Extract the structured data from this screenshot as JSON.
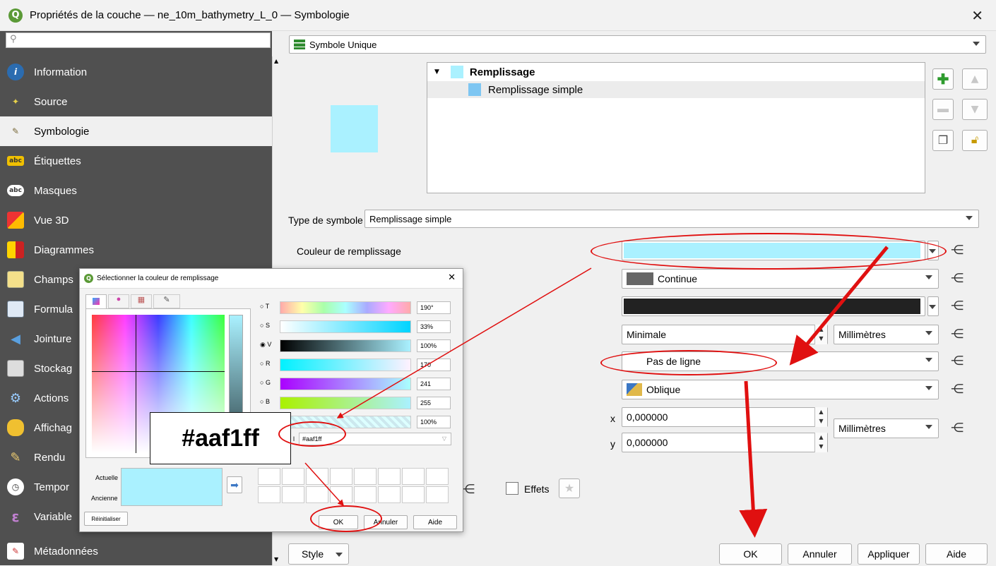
{
  "window": {
    "title": "Propriétés de la couche — ne_10m_bathymetry_L_0 — Symbologie",
    "logo": "Q"
  },
  "sidebar": {
    "search_placeholder": "",
    "items": [
      {
        "label": "Information",
        "icon": "info-icon"
      },
      {
        "label": "Source",
        "icon": "source-icon"
      },
      {
        "label": "Symbologie",
        "icon": "brush-icon"
      },
      {
        "label": "Étiquettes",
        "icon": "labels-icon"
      },
      {
        "label": "Masques",
        "icon": "masks-icon"
      },
      {
        "label": "Vue 3D",
        "icon": "cube-icon"
      },
      {
        "label": "Diagrammes",
        "icon": "diagram-icon"
      },
      {
        "label": "Champs",
        "icon": "fields-icon"
      },
      {
        "label": "Formula",
        "icon": "form-icon"
      },
      {
        "label": "Jointure",
        "icon": "join-icon"
      },
      {
        "label": "Stockag",
        "icon": "storage-icon"
      },
      {
        "label": "Actions",
        "icon": "actions-icon"
      },
      {
        "label": "Affichag",
        "icon": "display-icon"
      },
      {
        "label": "Rendu",
        "icon": "render-icon"
      },
      {
        "label": "Tempor",
        "icon": "clock-icon"
      },
      {
        "label": "Variable",
        "icon": "variable-icon"
      },
      {
        "label": "Métadonnées",
        "icon": "metadata-icon"
      }
    ]
  },
  "renderer": {
    "label": "Symbole Unique"
  },
  "tree": {
    "root": "Remplissage",
    "child": "Remplissage simple"
  },
  "symbol": {
    "type_label": "Type de symbole",
    "type_value": "Remplissage simple",
    "fill_color_label": "Couleur de remplissage",
    "fill_color": "#aaf1ff",
    "stroke_style": "Continue",
    "stroke_width": "Minimale",
    "stroke_unit": "Millimètres",
    "brush_style": "Pas de ligne",
    "join_style": "Oblique",
    "offset_x_label": "x",
    "offset_x": "0,000000",
    "offset_y_label": "y",
    "offset_y": "0,000000",
    "offset_unit": "Millimètres",
    "effects_label": "Effets"
  },
  "buttons": {
    "style": "Style",
    "ok": "OK",
    "cancel": "Annuler",
    "apply": "Appliquer",
    "help": "Aide"
  },
  "color_dialog": {
    "title": "Sélectionner la couleur de remplissage",
    "sliders": [
      {
        "key": "T",
        "value": "190°"
      },
      {
        "key": "S",
        "value": "33%"
      },
      {
        "key": "V",
        "value": "100%"
      },
      {
        "key": "R",
        "value": "170"
      },
      {
        "key": "G",
        "value": "241"
      },
      {
        "key": "B",
        "value": "255"
      },
      {
        "key": "",
        "value": "100%"
      }
    ],
    "hex_label": "l",
    "hex_value": "#aaf1ff",
    "current_label": "Actuelle",
    "previous_label": "Ancienne",
    "reset": "Réinitialiser",
    "ok": "OK",
    "cancel": "Annuler",
    "help": "Aide"
  },
  "annotation": {
    "callout": "#aaf1ff",
    "color": "#e01010"
  }
}
